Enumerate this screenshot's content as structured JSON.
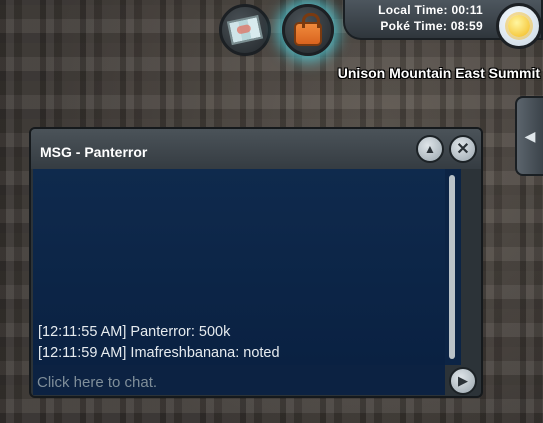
{
  "hud": {
    "map_icon": "map-icon",
    "bag_icon": "bag-icon",
    "weather_icon": "sun-icon",
    "local_time_label": "Local Time: 00:11",
    "poke_time_label": "Poké Time: 08:59",
    "location": "Unison Mountain East Summit",
    "side_tab_arrow": "◀",
    "accent_glow": "#50dceb"
  },
  "chat": {
    "title": "MSG - Panterror",
    "scroll_up_symbol": "▲",
    "close_symbol": "✕",
    "send_symbol": "▶",
    "messages": [
      "[12:11:55 AM] Panterror: 500k",
      "[12:11:59 AM] Imafreshbanana: noted"
    ],
    "input_placeholder": "Click here to chat.",
    "body_color": "#0f2a4d"
  }
}
